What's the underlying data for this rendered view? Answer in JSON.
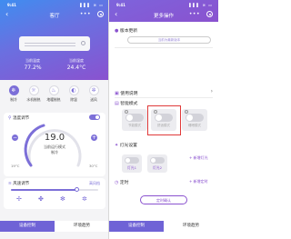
{
  "left": {
    "status": {
      "time": "9:41",
      "signal": "▌▌▌ ≋ ▭"
    },
    "nav": {
      "title": "客厅",
      "back": "‹",
      "more": "•••"
    },
    "current_temp": {
      "label": "当前温度",
      "value": "77.2%"
    },
    "current_humidity": {
      "label": "当前湿度",
      "value": "24.4°C"
    },
    "modes": [
      {
        "label": "制冷",
        "icon": "snowflake-icon",
        "glyph": "❄",
        "active": true
      },
      {
        "label": "水机制热",
        "icon": "sun-icon",
        "glyph": "☼",
        "active": false
      },
      {
        "label": "地暖制热",
        "icon": "heat-icon",
        "glyph": "♨",
        "active": false
      },
      {
        "label": "除湿",
        "icon": "droplet-icon",
        "glyph": "◐",
        "active": false
      },
      {
        "label": "送风",
        "icon": "fan-icon",
        "glyph": "✲",
        "active": false
      }
    ],
    "temp_card": {
      "title": "温度调节",
      "setpoint": "19.0",
      "mode_line": "当前运行模式",
      "mode_value": "制冷",
      "min": "19°C",
      "max": "30°C",
      "minus": "−",
      "plus": "+"
    },
    "fan_card": {
      "title": "风速调节",
      "speed_label": "高风档",
      "level": 0.75
    },
    "tabs": [
      "设备控制",
      "环境趋势"
    ]
  },
  "right": {
    "status": {
      "time": "9:41",
      "signal": "▌▌▌ ≋ ▭"
    },
    "nav": {
      "title": "更多操作",
      "back": "‹",
      "more": "•••"
    },
    "version": {
      "title": "版本更新",
      "placeholder": "当前为最新版本"
    },
    "manual": {
      "title": "使用说明",
      "chevron": "›"
    },
    "smart": {
      "title": "智能模式"
    },
    "scenes": [
      {
        "label": "节能模式"
      },
      {
        "label": "舒适模式"
      },
      {
        "label": "睡眠模式"
      }
    ],
    "lights": {
      "title": "灯光设置",
      "items": [
        "灯光1",
        "灯光2"
      ],
      "add": "+ 新增灯光"
    },
    "timer": {
      "title": "定时",
      "add": "+ 新增定时",
      "button": "定时确认"
    },
    "tabs": [
      "设备控制",
      "环境趋势"
    ]
  },
  "colors": {
    "accent": "#7c6fd8",
    "highlight": "#e03a3a"
  }
}
